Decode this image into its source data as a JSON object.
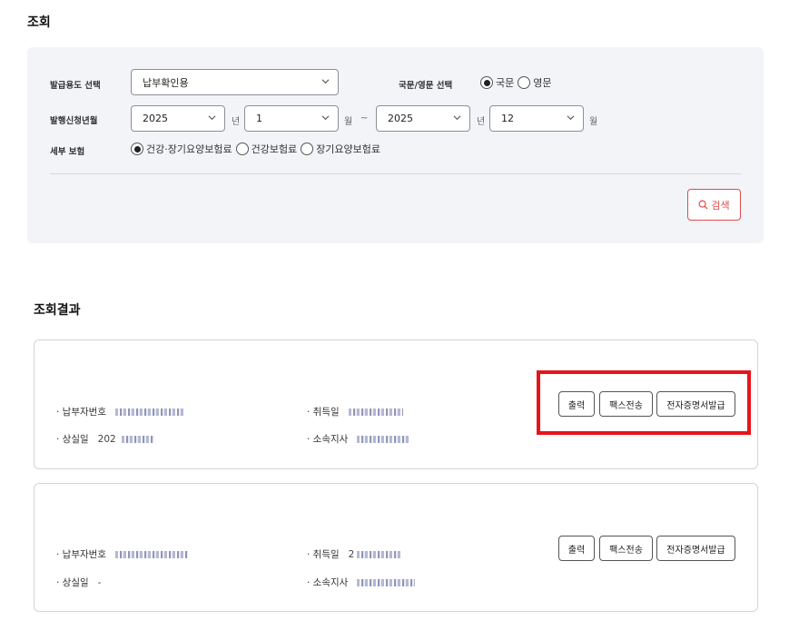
{
  "search": {
    "title": "조회",
    "purpose_label": "발급용도 선택",
    "purpose_value": "납부확인용",
    "language_label": "국문/영문 선택",
    "language_options": [
      "국문",
      "영문"
    ],
    "language_selected": "국문",
    "period_label": "발행신청년월",
    "from_year": "2025",
    "from_month": "1",
    "to_year": "2025",
    "to_month": "12",
    "year_unit": "년",
    "month_unit": "월",
    "range_sep": "~",
    "insurance_label": "세부 보험",
    "insurance_options": [
      "건강·장기요양보험료",
      "건강보험료",
      "장기요양보험료"
    ],
    "insurance_selected": "건강·장기요양보험료",
    "search_button": "검색",
    "search_icon": "search-icon"
  },
  "results": {
    "title": "조회결과",
    "cards": [
      {
        "payer_label": "· 납부자번호",
        "acquired_label": "· 취득일",
        "lost_label": "· 상실일",
        "lost_value": "202",
        "branch_label": "· 소속지사",
        "buttons": [
          "출력",
          "팩스전송",
          "전자증명서발급"
        ]
      },
      {
        "payer_label": "· 납부자번호",
        "acquired_label": "· 취득일",
        "acquired_value": "2",
        "lost_label": "· 상실일",
        "lost_value": "-",
        "branch_label": "· 소속지사",
        "buttons": [
          "출력",
          "팩스전송",
          "전자증명서발급"
        ]
      }
    ]
  },
  "colors": {
    "accent": "#e14b4b",
    "highlight": "#e8141b",
    "panel_bg": "#f3f4f8"
  }
}
